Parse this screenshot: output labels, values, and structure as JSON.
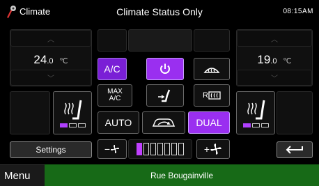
{
  "header": {
    "app_title": "Climate",
    "screen_title": "Climate Status Only",
    "clock": "08:15AM"
  },
  "left_zone": {
    "temp_main": "24",
    "temp_decimal": ".0",
    "temp_unit": "℃"
  },
  "right_zone": {
    "temp_main": "19",
    "temp_decimal": ".0",
    "temp_unit": "℃"
  },
  "controls": {
    "ac_label": "A/C",
    "max_ac_top": "MAX",
    "max_ac_bottom": "A/C",
    "auto_label": "AUTO",
    "dual_label": "DUAL",
    "rear_defrost_prefix": "R"
  },
  "fan": {
    "minus": "−",
    "plus": "+",
    "level": 1,
    "levels": 7
  },
  "seat_heat": {
    "left_level": 1,
    "right_level": 1,
    "max_level": 3
  },
  "settings_label": "Settings",
  "footer": {
    "menu_label": "Menu",
    "street": "Rue Bougainville"
  },
  "colors": {
    "accent_purple": "#7a1fd6",
    "street_green": "#176a17"
  }
}
